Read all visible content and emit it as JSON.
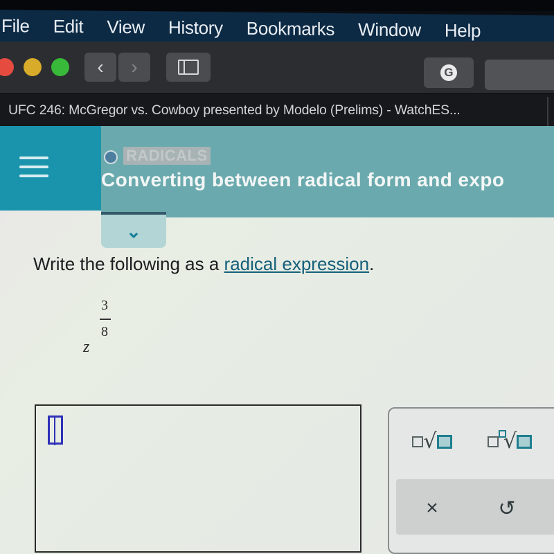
{
  "menubar": {
    "items": [
      "File",
      "Edit",
      "View",
      "History",
      "Bookmarks",
      "Window",
      "Help"
    ]
  },
  "toolbar": {
    "back_glyph": "‹",
    "forward_glyph": "›",
    "grammarly_glyph": "G",
    "icons": [
      "close-window",
      "minimize-window",
      "zoom-window",
      "back",
      "forward",
      "sidebar",
      "grammarly"
    ]
  },
  "tab": {
    "title": "UFC 246: McGregor vs. Cowboy presented by Modelo (Prelims) - WatchES..."
  },
  "lesson": {
    "topic": "RADICALS",
    "title": "Converting between radical form and expo",
    "expand_glyph": "⌄"
  },
  "question": {
    "prompt_prefix": "Write the following as a ",
    "link_text": "radical expression",
    "prompt_suffix": ".",
    "base": "z",
    "exponent_numerator": "3",
    "exponent_denominator": "8"
  },
  "answer": {
    "value": ""
  },
  "keypad": {
    "sqrt_symbol": "√",
    "nroot_symbol": "√",
    "clear_glyph": "×",
    "undo_glyph": "↺"
  },
  "colors": {
    "menubar": "#0d2a45",
    "header_left": "#1a94ad",
    "header_main": "#6aaaae",
    "link": "#15607a",
    "cursor": "#2f31b8",
    "keypad_accent": "#1e7e8f"
  }
}
